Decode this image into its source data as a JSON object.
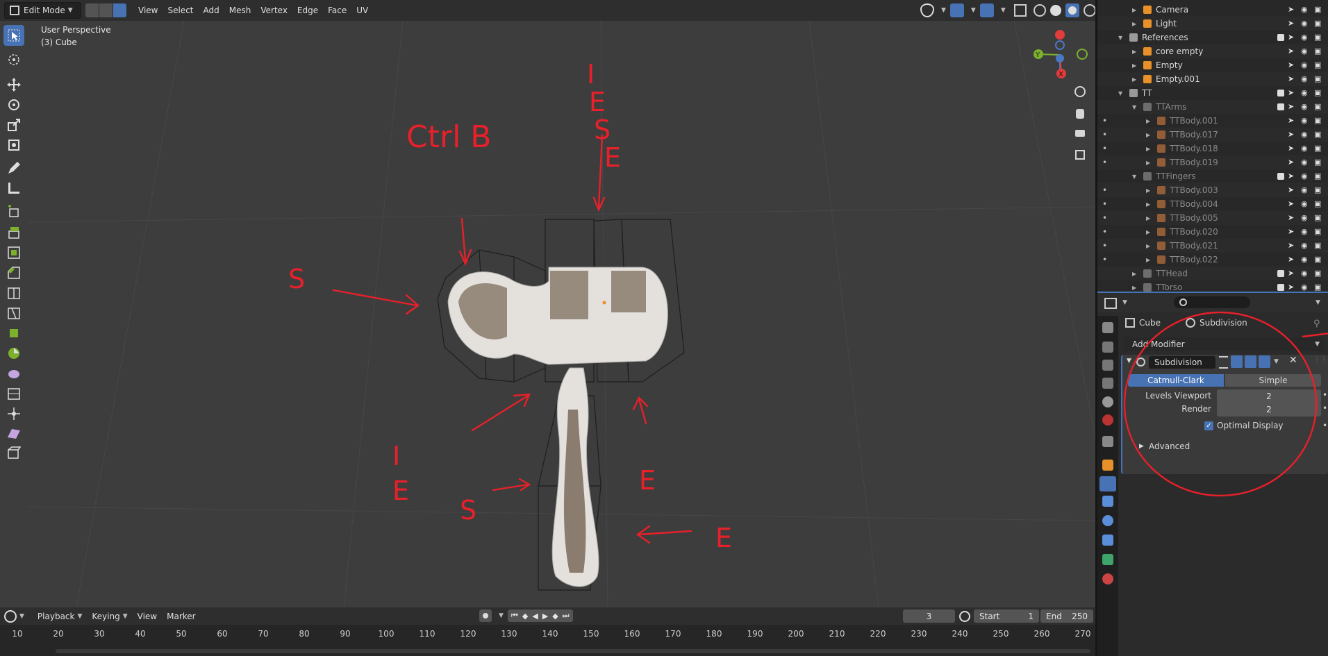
{
  "header": {
    "mode": "Edit Mode",
    "menus": [
      "View",
      "Select",
      "Add",
      "Mesh",
      "Vertex",
      "Edge",
      "Face",
      "UV"
    ]
  },
  "viewport": {
    "perspective": "User Perspective",
    "object": "(3) Cube",
    "gizmo": {
      "y": "Y",
      "x": "X"
    },
    "annotations": {
      "ctrl_b": "Ctrl B",
      "ie_top": "I E S E",
      "s_left": "S",
      "ie_bottom": "I E",
      "e_right": "E",
      "s_bottom": "S",
      "e_far": "E"
    }
  },
  "timeline": {
    "menus": [
      "Playback",
      "Keying",
      "View",
      "Marker"
    ],
    "current_frame": "3",
    "start_label": "Start",
    "start": "1",
    "end_label": "End",
    "end": "250",
    "ticks": [
      "10",
      "20",
      "30",
      "40",
      "50",
      "60",
      "70",
      "80",
      "90",
      "100",
      "110",
      "120",
      "130",
      "140",
      "150",
      "160",
      "170",
      "180",
      "190",
      "200",
      "210",
      "220",
      "230",
      "240",
      "250",
      "260",
      "270"
    ]
  },
  "outliner": {
    "rows": [
      {
        "label": "Camera",
        "indent": 3,
        "dim": false
      },
      {
        "label": "Light",
        "indent": 3,
        "dim": false
      },
      {
        "label": "References",
        "indent": 2,
        "dim": false
      },
      {
        "label": "core empty",
        "indent": 3,
        "dim": false
      },
      {
        "label": "Empty",
        "indent": 3,
        "dim": false
      },
      {
        "label": "Empty.001",
        "indent": 3,
        "dim": false
      },
      {
        "label": "TT",
        "indent": 2,
        "dim": false
      },
      {
        "label": "TTArms",
        "indent": 3,
        "dim": true
      },
      {
        "label": "TTBody.001",
        "indent": 4,
        "dim": true
      },
      {
        "label": "TTBody.017",
        "indent": 4,
        "dim": true
      },
      {
        "label": "TTBody.018",
        "indent": 4,
        "dim": true
      },
      {
        "label": "TTBody.019",
        "indent": 4,
        "dim": true
      },
      {
        "label": "TTFingers",
        "indent": 3,
        "dim": true
      },
      {
        "label": "TTBody.003",
        "indent": 4,
        "dim": true
      },
      {
        "label": "TTBody.004",
        "indent": 4,
        "dim": true
      },
      {
        "label": "TTBody.005",
        "indent": 4,
        "dim": true
      },
      {
        "label": "TTBody.020",
        "indent": 4,
        "dim": true
      },
      {
        "label": "TTBody.021",
        "indent": 4,
        "dim": true
      },
      {
        "label": "TTBody.022",
        "indent": 4,
        "dim": true
      },
      {
        "label": "TTHead",
        "indent": 3,
        "dim": true
      },
      {
        "label": "TTorso",
        "indent": 3,
        "dim": true
      }
    ],
    "badges": {
      "core_empty": "1",
      "tthead": "2",
      "ttorso": "9"
    }
  },
  "properties": {
    "breadcrumb_object": "Cube",
    "breadcrumb_modifier": "Subdivision",
    "add_modifier": "Add Modifier",
    "modifier_name": "Subdivision",
    "type_catmull": "Catmull-Clark",
    "type_simple": "Simple",
    "levels_viewport_label": "Levels Viewport",
    "levels_viewport": "2",
    "render_label": "Render",
    "render": "2",
    "optimal_display": "Optimal Display",
    "advanced": "Advanced"
  }
}
